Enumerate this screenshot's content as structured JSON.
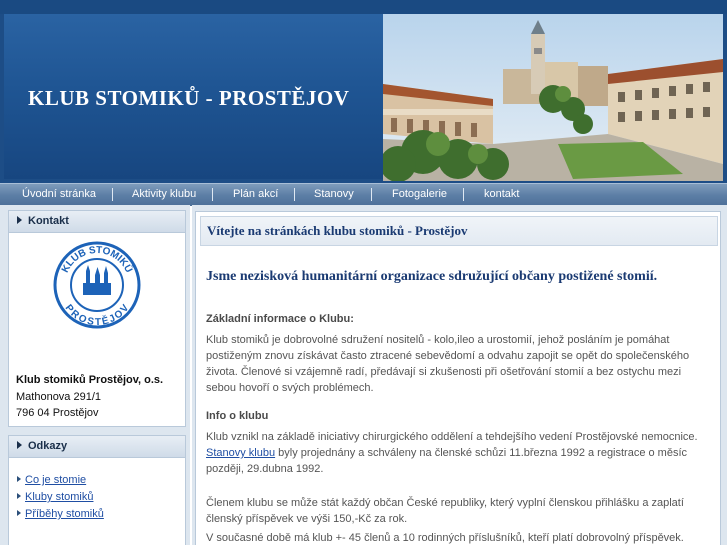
{
  "header": {
    "site_title": "KLUB STOMIKŮ - PROSTĚJOV"
  },
  "nav": {
    "items": [
      {
        "label": "Úvodní stránka"
      },
      {
        "label": "Aktivity klubu"
      },
      {
        "label": "Plán akcí"
      },
      {
        "label": "Stanovy"
      },
      {
        "label": "Fotogalerie"
      },
      {
        "label": "kontakt"
      }
    ]
  },
  "sidebar": {
    "contact": {
      "heading": "Kontakt",
      "logo": {
        "top_text": "KLUB STOMIKŮ",
        "bottom_text": "PROSTĚJOV"
      },
      "org_name": "Klub stomiků Prostějov, o.s.",
      "street": "Mathonova 291/1",
      "city": "796 04 Prostějov"
    },
    "links": {
      "heading": "Odkazy",
      "items": [
        {
          "label": "Co je stomie"
        },
        {
          "label": "Kluby stomiků"
        },
        {
          "label": "Příběhy stomiků"
        }
      ]
    }
  },
  "main": {
    "welcome": "Vítejte na stránkách klubu stomiků - Prostějov",
    "subtitle": "Jsme nezisková humanitární organizace sdružující občany postižené stomií.",
    "section1_heading": "Základní informace o Klubu:",
    "section1_text": "Klub stomiků je dobrovolné sdružení nositelů  - kolo,ileo a urostomií, jehož posláním je pomáhat postiženým znovu získávat často ztracené sebevědomí a odvahu zapojit se opět do společenského života. Členové si vzájemně radí, předávají si zkušenosti při ošetřování stomií a bez ostychu mezi sebou hovoří o svých problémech.",
    "section2_heading": "Info o klubu",
    "section2_text_before": "Klub vznikl na základě iniciativy chirurgického oddělení a tehdejšího vedení Prostějovské nemocnice.",
    "section2_link": "Stanovy klubu",
    "section2_text_after": " byly projednány a schváleny na členské schůzi 11.března 1992 a registrace o měsíc později, 29.dubna 1992.",
    "section3_text": "Členem klubu se může stát každý občan České republiky, který vyplní členskou přihlášku a zaplatí členský příspěvek ve výši 150,-Kč za rok.",
    "section4_text": "V současné době má klub +- 45 členů a 10 rodinných příslušníků, kteří platí dobrovolný příspěvek."
  }
}
